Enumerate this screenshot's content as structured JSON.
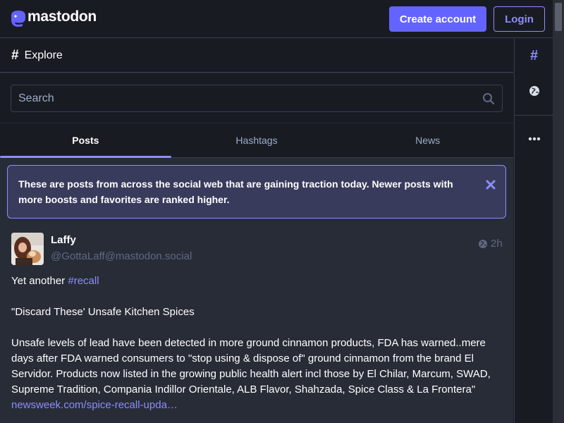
{
  "header": {
    "logo_text": "mastodon",
    "create_account_label": "Create account",
    "login_label": "Login"
  },
  "column": {
    "title": "Explore"
  },
  "search": {
    "placeholder": "Search"
  },
  "tabs": [
    {
      "label": "Posts",
      "active": true
    },
    {
      "label": "Hashtags",
      "active": false
    },
    {
      "label": "News",
      "active": false
    }
  ],
  "notice": {
    "text": "These are posts from across the social web that are gaining traction today. Newer posts with more boosts and favorites are ranked higher."
  },
  "post": {
    "display_name": "Laffy",
    "handle": "@GottaLaff@mastodon.social",
    "time": "2h",
    "line1_prefix": "Yet another ",
    "line1_hashtag": "#recall",
    "line2": "\"Discard These' Unsafe Kitchen Spices",
    "line3": "Unsafe levels of lead have been detected in more ground cinnamon products, FDA has warned..mere days after FDA warned consumers to \"stop using & dispose of\" ground cinnamon from the brand El Servidor. Products now listed in the growing public health alert incl those by El Chilar, Marcum, SWAD, Supreme Tradition, Compania Indillor Orientale, ALB Flavor, Shahzada, Spice Class & La Frontera\"",
    "link": "newsweek.com/spice-recall-upda…"
  },
  "colors": {
    "accent": "#6364ff",
    "accent_light": "#8c8dff",
    "background": "#191b22",
    "panel": "#282c37",
    "muted_text": "#606984"
  },
  "icons": {
    "logo": "mastodon-logo-icon",
    "explore": "hashtag-icon",
    "search": "search-icon",
    "close": "close-icon",
    "visibility": "globe-icon",
    "sidebar": [
      "hashtag-icon",
      "globe-icon",
      "ellipsis-icon"
    ]
  }
}
